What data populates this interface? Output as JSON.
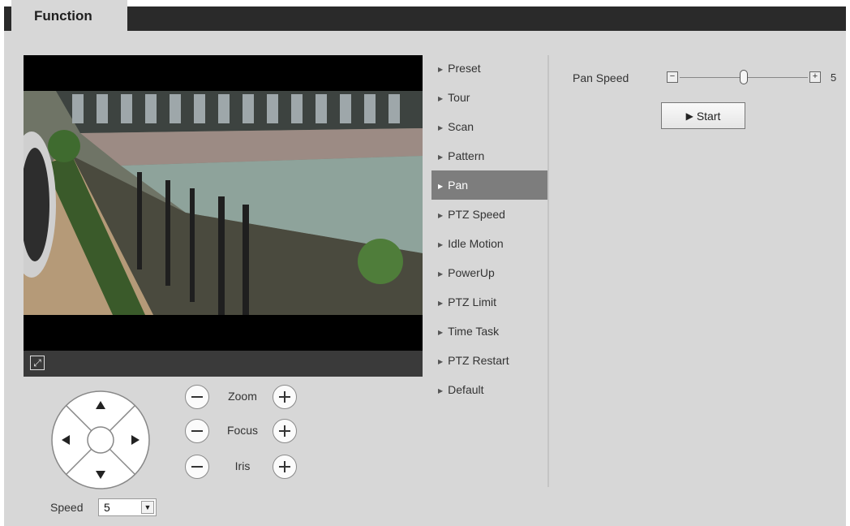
{
  "tab": {
    "label": "Function"
  },
  "video": {
    "fullscreen_icon": "fullscreen-icon"
  },
  "controls": {
    "zoom": {
      "label": "Zoom"
    },
    "focus": {
      "label": "Focus"
    },
    "iris": {
      "label": "Iris"
    },
    "speed": {
      "label": "Speed",
      "value": "5"
    }
  },
  "menu": {
    "items": [
      {
        "label": "Preset",
        "active": false
      },
      {
        "label": "Tour",
        "active": false
      },
      {
        "label": "Scan",
        "active": false
      },
      {
        "label": "Pattern",
        "active": false
      },
      {
        "label": "Pan",
        "active": true
      },
      {
        "label": "PTZ Speed",
        "active": false
      },
      {
        "label": "Idle Motion",
        "active": false
      },
      {
        "label": "PowerUp",
        "active": false
      },
      {
        "label": "PTZ Limit",
        "active": false
      },
      {
        "label": "Time Task",
        "active": false
      },
      {
        "label": "PTZ Restart",
        "active": false
      },
      {
        "label": "Default",
        "active": false
      }
    ]
  },
  "pan": {
    "label": "Pan Speed",
    "minus": "−",
    "plus": "+",
    "value": "5",
    "level_fraction": 0.5,
    "start_label": "Start"
  }
}
